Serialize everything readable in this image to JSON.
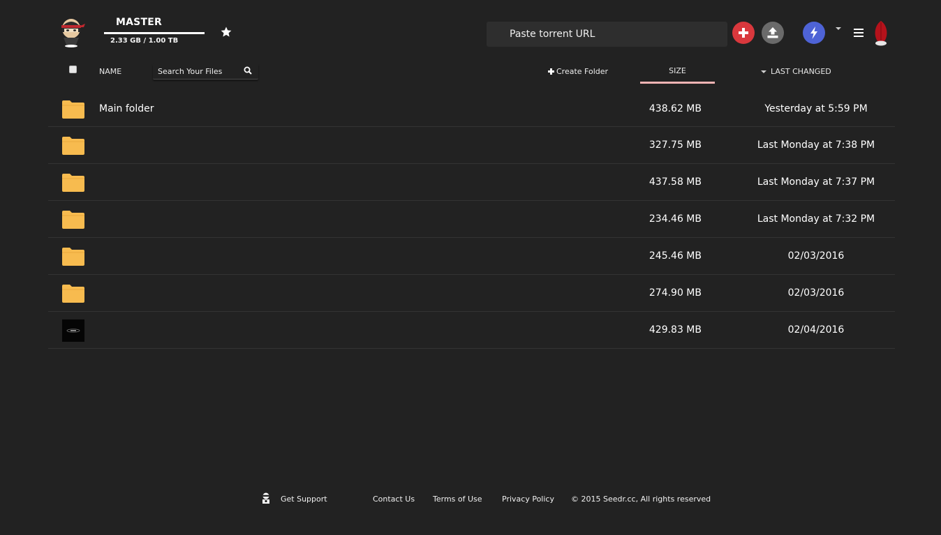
{
  "header": {
    "user_name": "MASTER",
    "storage_usage": "2.33 GB / 1.00 TB",
    "storage_used_fraction": 1.0,
    "url_input": {
      "value": "",
      "placeholder": "Paste torrent URL"
    },
    "icons": {
      "avatar": "ninja-avatar-icon",
      "favorite": "star-icon",
      "add": "plus-circle-icon",
      "upload": "upload-icon",
      "premium": "lightning-icon",
      "dropdown": "chevron-down-icon",
      "menu": "hamburger-menu-icon",
      "brand": "seedr-feather-logo"
    }
  },
  "toolbar": {
    "name_label": "NAME",
    "search_placeholder": "Search Your Files",
    "create_folder_label": "Create Folder",
    "size_label": "SIZE",
    "last_changed_label": "LAST CHANGED"
  },
  "files": [
    {
      "name": "Main folder",
      "size": "438.62 MB",
      "changed": "Yesterday at 5:59 PM",
      "thumb": "folder-icon"
    },
    {
      "name": "",
      "size": "327.75 MB",
      "changed": "Last Monday at 7:38 PM",
      "thumb": "folder-icon"
    },
    {
      "name": "",
      "size": "437.58 MB",
      "changed": "Last Monday at 7:37 PM",
      "thumb": "folder-icon"
    },
    {
      "name": "",
      "size": "234.46 MB",
      "changed": "Last Monday at 7:32 PM",
      "thumb": "folder-icon"
    },
    {
      "name": "",
      "size": "245.46 MB",
      "changed": "02/03/2016",
      "thumb": "folder-icon"
    },
    {
      "name": "",
      "size": "274.90 MB",
      "changed": "02/03/2016",
      "thumb": "folder-icon"
    },
    {
      "name": "",
      "size": "429.83 MB",
      "changed": "02/04/2016",
      "thumb": "video-thumbnail"
    }
  ],
  "footer": {
    "support_label": "Get Support",
    "contact_label": "Contact Us",
    "terms_label": "Terms of Use",
    "privacy_label": "Privacy Policy",
    "copyright": "© 2015 Seedr.cc, All rights reserved"
  },
  "colors": {
    "background": "#222222",
    "row_divider": "#333333",
    "folder": "#f7bb4f",
    "add_button": "#d9383d",
    "upload_button": "#6a6a6a",
    "premium_button": "#4e63d6",
    "brand_red": "#b5121b",
    "active_sort_underline": "#f2b4b4"
  }
}
